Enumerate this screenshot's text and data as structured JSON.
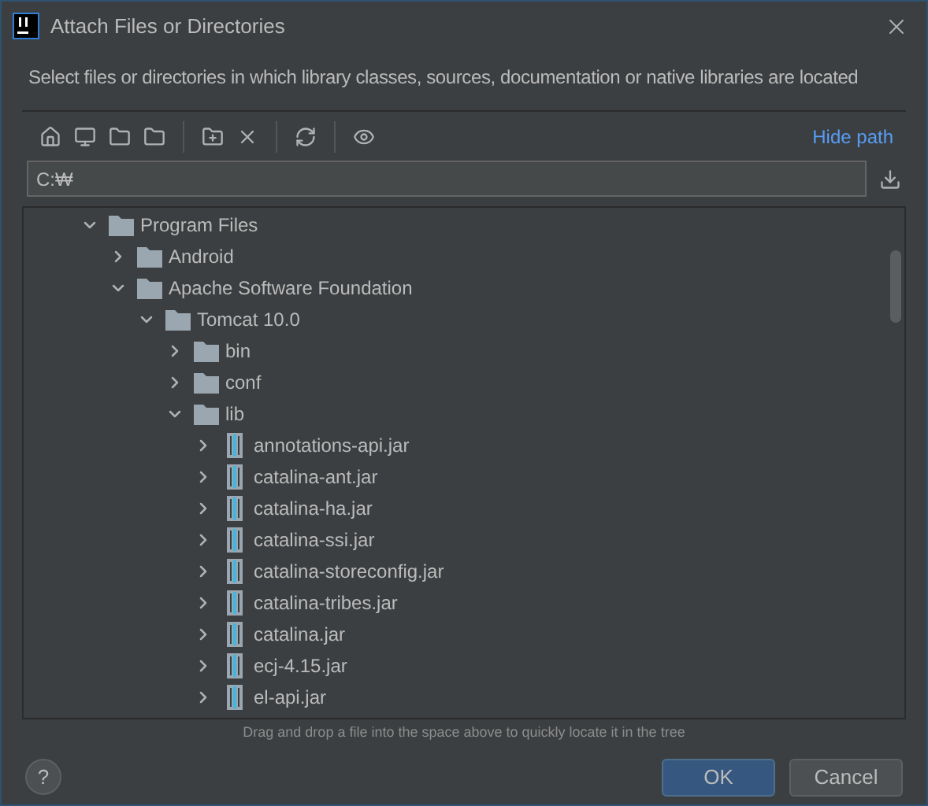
{
  "window": {
    "title": "Attach Files or Directories"
  },
  "description": "Select files or directories in which library classes, sources, documentation or native libraries are located",
  "toolbar": {
    "hide_path_link": "Hide path"
  },
  "path_field": {
    "value": "C:₩"
  },
  "tree": [
    {
      "kind": "folder",
      "label": "Program Files",
      "expanded": true,
      "children": [
        {
          "kind": "folder",
          "label": "Android",
          "expanded": false
        },
        {
          "kind": "folder",
          "label": "Apache Software Foundation",
          "expanded": true,
          "children": [
            {
              "kind": "folder",
              "label": "Tomcat 10.0",
              "expanded": true,
              "children": [
                {
                  "kind": "folder",
                  "label": "bin",
                  "expanded": false
                },
                {
                  "kind": "folder",
                  "label": "conf",
                  "expanded": false
                },
                {
                  "kind": "folder",
                  "label": "lib",
                  "expanded": true,
                  "children": [
                    {
                      "kind": "jar",
                      "label": "annotations-api.jar",
                      "expanded": false
                    },
                    {
                      "kind": "jar",
                      "label": "catalina-ant.jar",
                      "expanded": false
                    },
                    {
                      "kind": "jar",
                      "label": "catalina-ha.jar",
                      "expanded": false
                    },
                    {
                      "kind": "jar",
                      "label": "catalina-ssi.jar",
                      "expanded": false
                    },
                    {
                      "kind": "jar",
                      "label": "catalina-storeconfig.jar",
                      "expanded": false
                    },
                    {
                      "kind": "jar",
                      "label": "catalina-tribes.jar",
                      "expanded": false
                    },
                    {
                      "kind": "jar",
                      "label": "catalina.jar",
                      "expanded": false
                    },
                    {
                      "kind": "jar",
                      "label": "ecj-4.15.jar",
                      "expanded": false
                    },
                    {
                      "kind": "jar",
                      "label": "el-api.jar",
                      "expanded": false
                    }
                  ]
                }
              ]
            }
          ]
        }
      ]
    }
  ],
  "hint": "Drag and drop a file into the space above to quickly locate it in the tree",
  "buttons": {
    "help": "?",
    "ok": "OK",
    "cancel": "Cancel"
  }
}
